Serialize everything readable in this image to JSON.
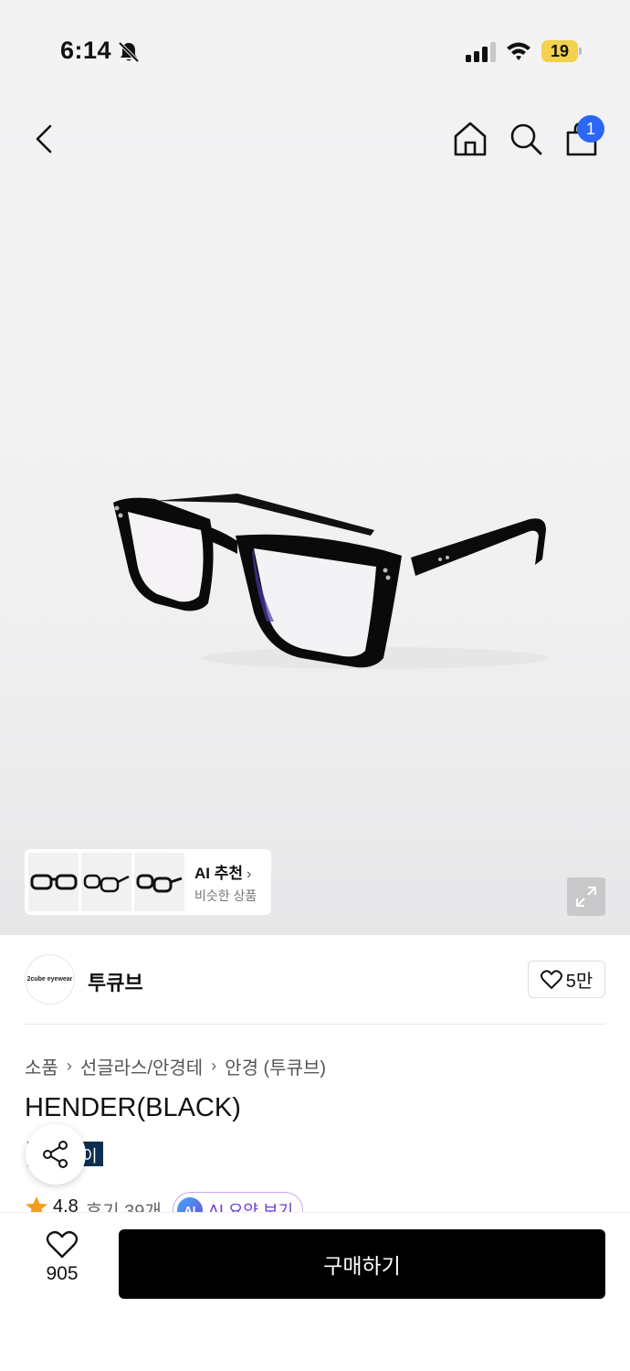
{
  "status_bar": {
    "time": "6:14",
    "battery": "19"
  },
  "header": {
    "cart_count": "1"
  },
  "ai_recommend": {
    "title": "AI 추천",
    "subtitle": "비슷한 상품"
  },
  "brand": {
    "name": "투큐브",
    "logo_text": "2cube eyewear",
    "like_count": "5만"
  },
  "breadcrumb": [
    "소품",
    "선글라스/안경테",
    "안경 (투큐브)"
  ],
  "product": {
    "title": "HENDER(BLACK)",
    "badge_visible_text": "이",
    "rating": "4.8",
    "reviews": "후기 39개",
    "ai_summary_icon": "AI",
    "ai_summary_label": "AI 요약 보기"
  },
  "bottom": {
    "wish_count": "905",
    "buy_label": "구매하기"
  },
  "colors": {
    "cart_badge": "#2b67f6",
    "buy_button": "#000000",
    "badge_bg": "#0d2f4f",
    "star": "#f39c1f"
  }
}
